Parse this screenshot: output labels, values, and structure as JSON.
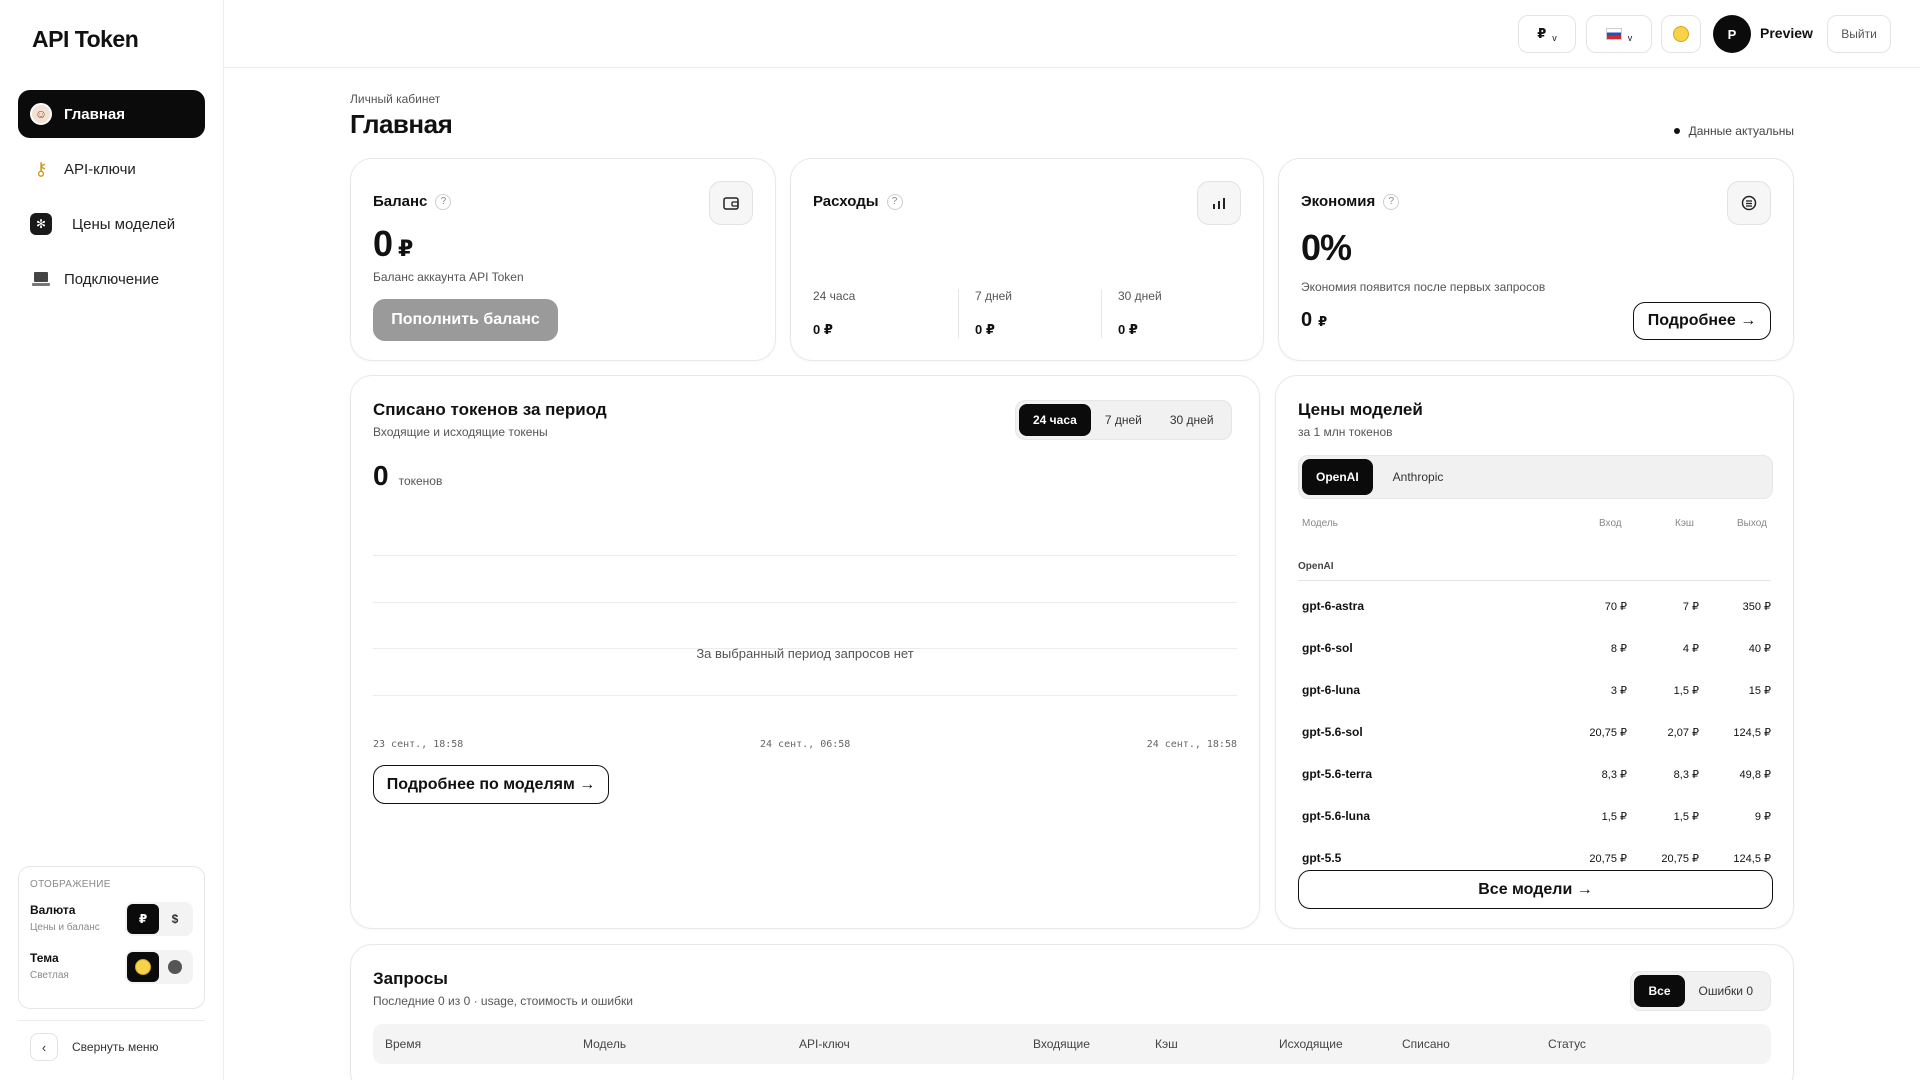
{
  "brand": "API Token",
  "sidebar": {
    "items": [
      {
        "label": "Главная",
        "icon": "avatar-home-icon"
      },
      {
        "label": "API-ключи",
        "icon": "key-icon"
      },
      {
        "label": "Цены моделей",
        "icon": "openai-logo-icon"
      },
      {
        "label": "Подключение",
        "icon": "laptop-icon"
      }
    ],
    "display": {
      "title": "ОТОБРАЖЕНИЕ",
      "currency_label": "Валюта",
      "currency_sub": "Цены и баланс",
      "currency_options": [
        "₽",
        "$"
      ],
      "theme_label": "Тема",
      "theme_sub": "Светлая"
    },
    "collapse_label": "Свернуть меню"
  },
  "topbar": {
    "currency": "₽",
    "caret": "v",
    "avatar_letter": "P",
    "user_name": "Preview",
    "logout": "Выйти"
  },
  "header": {
    "breadcrumb": "Личный кабинет",
    "title": "Главная",
    "status": "Данные актуальны"
  },
  "balance": {
    "title": "Баланс",
    "help": "?",
    "value": "0",
    "currency": "₽",
    "subtitle": "Баланс аккаунта API Token",
    "button": "Пополнить баланс"
  },
  "expenses": {
    "title": "Расходы",
    "help": "?",
    "periods": [
      {
        "label": "24 часа",
        "value": "0 ₽"
      },
      {
        "label": "7 дней",
        "value": "0 ₽"
      },
      {
        "label": "30 дней",
        "value": "0 ₽"
      }
    ]
  },
  "savings": {
    "title": "Экономия",
    "help": "?",
    "value": "0%",
    "subtitle": "Экономия появится после первых запросов",
    "amount": "0",
    "currency": "₽",
    "button": "Подробнее →"
  },
  "tokens": {
    "title": "Списано токенов за период",
    "subtitle": "Входящие и исходящие токены",
    "tabs": [
      "24 часа",
      "7 дней",
      "30 дней"
    ],
    "active_tab": "24 часа",
    "value": "0",
    "unit": "токенов",
    "empty": "За выбранный период запросов нет",
    "axis": [
      "23 сент., 18:58",
      "24 сент., 06:58",
      "24 сент., 18:58"
    ],
    "button": "Подробнее по моделям →"
  },
  "prices": {
    "title": "Цены моделей",
    "subtitle": "за 1 млн токенов",
    "tabs": [
      "OpenAI",
      "Anthropic"
    ],
    "active_tab": "OpenAI",
    "columns": [
      "Модель",
      "Вход",
      "Кэш",
      "Выход"
    ],
    "group": "OpenAI",
    "rows": [
      {
        "model": "gpt-6-astra",
        "in": "70 ₽",
        "cache": "7 ₽",
        "out": "350 ₽"
      },
      {
        "model": "gpt-6-sol",
        "in": "8 ₽",
        "cache": "4 ₽",
        "out": "40 ₽"
      },
      {
        "model": "gpt-6-luna",
        "in": "3 ₽",
        "cache": "1,5 ₽",
        "out": "15 ₽"
      },
      {
        "model": "gpt-5.6-sol",
        "in": "20,75 ₽",
        "cache": "2,07 ₽",
        "out": "124,5 ₽"
      },
      {
        "model": "gpt-5.6-terra",
        "in": "8,3 ₽",
        "cache": "8,3 ₽",
        "out": "49,8 ₽"
      },
      {
        "model": "gpt-5.6-luna",
        "in": "1,5 ₽",
        "cache": "1,5 ₽",
        "out": "9 ₽"
      },
      {
        "model": "gpt-5.5",
        "in": "20,75 ₽",
        "cache": "20,75 ₽",
        "out": "124,5 ₽"
      }
    ],
    "button": "Все модели →"
  },
  "requests": {
    "title": "Запросы",
    "subtitle": "Последние 0 из 0 · usage, стоимость и ошибки",
    "filter_all": "Все",
    "filter_errors": "Ошибки 0",
    "columns": [
      "Время",
      "Модель",
      "API-ключ",
      "Входящие",
      "Кэш",
      "Исходящие",
      "Списано",
      "Статус"
    ]
  }
}
